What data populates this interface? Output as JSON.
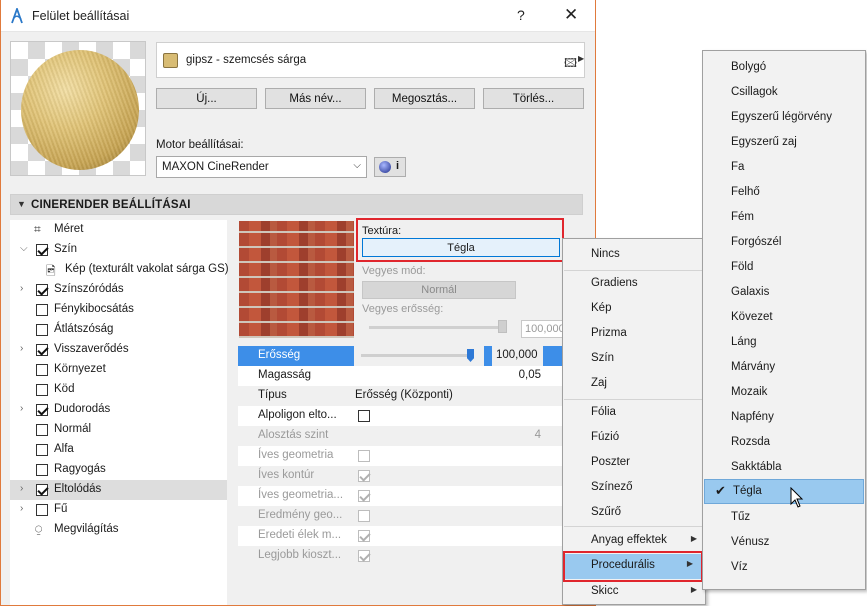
{
  "window": {
    "title": "Felület beállításai",
    "help": "?",
    "close": "✕"
  },
  "material": {
    "name": "gipsz - szemcsés sárga",
    "swatch_color": "#d8bc74"
  },
  "buttons": {
    "new": "Új...",
    "rename": "Más név...",
    "share": "Megosztás...",
    "delete": "Törlés..."
  },
  "engine": {
    "label": "Motor beállításai:",
    "value": "MAXON CineRender",
    "info": "i"
  },
  "section": {
    "title": "CINERENDER BEÁLLÍTÁSAI"
  },
  "tree": {
    "items": [
      {
        "label": "Méret"
      },
      {
        "label": "Szín"
      },
      {
        "label": "Kép (texturált vakolat sárga GS)"
      },
      {
        "label": "Színszóródás"
      },
      {
        "label": "Fénykibocsátás"
      },
      {
        "label": "Átlátszóság"
      },
      {
        "label": "Visszaverődés"
      },
      {
        "label": "Környezet"
      },
      {
        "label": "Köd"
      },
      {
        "label": "Dudorodás"
      },
      {
        "label": "Normál"
      },
      {
        "label": "Alfa"
      },
      {
        "label": "Ragyogás"
      },
      {
        "label": "Eltolódás"
      },
      {
        "label": "Fű"
      },
      {
        "label": "Megvilágítás"
      }
    ]
  },
  "texture": {
    "label": "Textúra:",
    "value": "Tégla",
    "blend_mode_label": "Vegyes mód:",
    "blend_mode_value": "Normál",
    "blend_strength_label": "Vegyes erősség:",
    "blend_strength_value": "100,000"
  },
  "props": {
    "strength_label": "Erősség",
    "strength_value": "100,000",
    "height_label": "Magasság",
    "height_value": "0,05",
    "type_label": "Típus",
    "type_value": "Erősség (Központi)",
    "subpoly_label": "Alpoligon elto...",
    "subdiv_label": "Alosztás szint",
    "subdiv_value": "4",
    "round_geom_label": "Íves geometria",
    "round_contour_label": "Íves kontúr",
    "round_geom2_label": "Íves geometria...",
    "result_geo_label": "Eredmény geo...",
    "orig_edges_label": "Eredeti élek m...",
    "best_dist_label": "Legjobb kioszt..."
  },
  "menu1": {
    "items": [
      "Nincs",
      "Gradiens",
      "Kép",
      "Prizma",
      "Szín",
      "Zaj",
      "Fólia",
      "Fúzió",
      "Poszter",
      "Színező",
      "Szűrő",
      "Anyag effektek",
      "Procedurális",
      "Skicc"
    ]
  },
  "menu2": {
    "items": [
      "Bolygó",
      "Csillagok",
      "Egyszerű légörvény",
      "Egyszerű zaj",
      "Fa",
      "Felhő",
      "Fém",
      "Forgószél",
      "Föld",
      "Galaxis",
      "Kövezet",
      "Láng",
      "Márvány",
      "Mozaik",
      "Napfény",
      "Rozsda",
      "Sakktábla",
      "Tégla",
      "Tűz",
      "Vénusz",
      "Víz"
    ],
    "selected": "Tégla"
  }
}
